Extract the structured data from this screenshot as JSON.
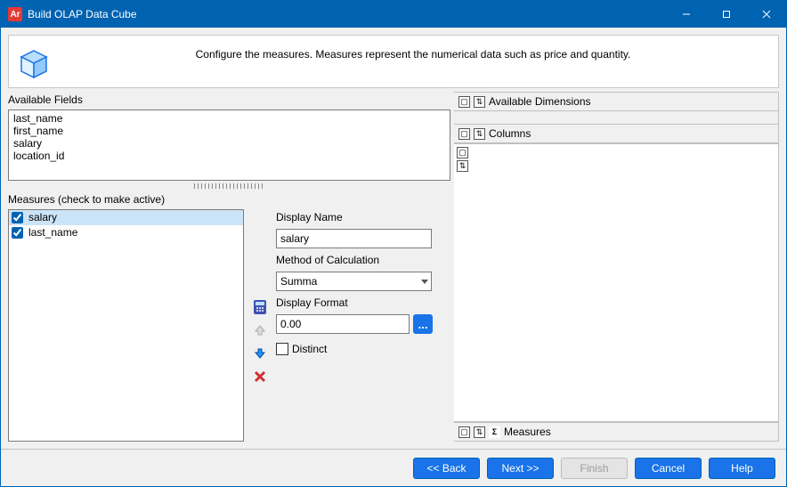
{
  "window": {
    "app_icon_text": "Ar",
    "title": "Build OLAP Data Cube"
  },
  "header": {
    "description": "Configure the measures.  Measures represent the numerical data such as price and quantity."
  },
  "available": {
    "label": "Available Fields",
    "items": [
      "last_name",
      "first_name",
      "salary",
      "location_id"
    ]
  },
  "measures": {
    "label": "Measures (check to make active)",
    "items": [
      {
        "label": "salary",
        "checked": true,
        "selected": true
      },
      {
        "label": "last_name",
        "checked": true,
        "selected": false
      }
    ]
  },
  "detail": {
    "display_name_label": "Display Name",
    "display_name_value": "salary",
    "method_label": "Method of Calculation",
    "method_value": "Summa",
    "format_label": "Display Format",
    "format_value": "0.00",
    "distinct_label": "Distinct",
    "ellipsis": "..."
  },
  "right": {
    "available_dimensions": "Available Dimensions",
    "columns": "Columns",
    "measures": "Measures"
  },
  "buttons": {
    "back": "<< Back",
    "next": "Next >>",
    "finish": "Finish",
    "cancel": "Cancel",
    "help": "Help"
  }
}
